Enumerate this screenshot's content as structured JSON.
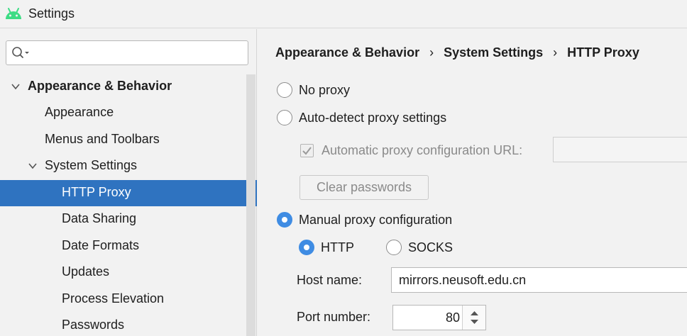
{
  "window": {
    "title": "Settings"
  },
  "search": {
    "placeholder": ""
  },
  "sidebar": {
    "items": [
      {
        "label": "Appearance & Behavior"
      },
      {
        "label": "Appearance"
      },
      {
        "label": "Menus and Toolbars"
      },
      {
        "label": "System Settings"
      },
      {
        "label": "HTTP Proxy"
      },
      {
        "label": "Data Sharing"
      },
      {
        "label": "Date Formats"
      },
      {
        "label": "Updates"
      },
      {
        "label": "Process Elevation"
      },
      {
        "label": "Passwords"
      }
    ]
  },
  "breadcrumb": {
    "items": [
      "Appearance & Behavior",
      "System Settings",
      "HTTP Proxy"
    ],
    "separator": "›"
  },
  "proxy": {
    "no_proxy_label": "No proxy",
    "auto_detect_label": "Auto-detect proxy settings",
    "auto_config_url_label": "Automatic proxy configuration URL:",
    "clear_passwords_label": "Clear passwords",
    "manual_label": "Manual proxy configuration",
    "http_label": "HTTP",
    "socks_label": "SOCKS",
    "host_label": "Host name:",
    "host_value": "mirrors.neusoft.edu.cn",
    "port_label": "Port number:",
    "port_value": "80"
  },
  "colors": {
    "selection": "#2f73c0",
    "radio_checked": "#3f8ce3",
    "android_green": "#3ddc84"
  },
  "icons": [
    "android-icon",
    "search-icon",
    "chevron-down-icon",
    "spinner-arrows-icon"
  ]
}
